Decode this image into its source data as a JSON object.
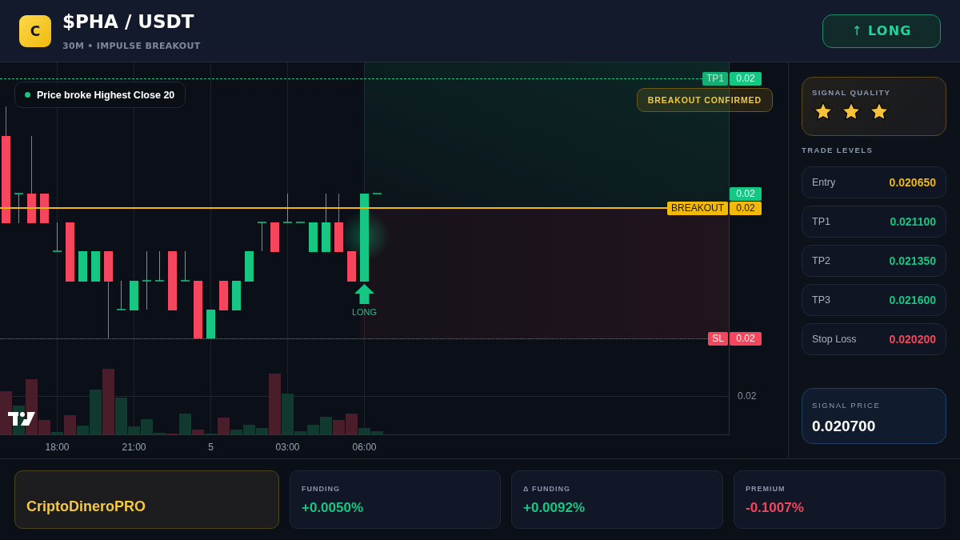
{
  "header": {
    "logo_letter": "C",
    "title": "$PHA / USDT",
    "subtitle": "30M • IMPULSE BREAKOUT",
    "direction": {
      "arrow": "↑",
      "label": "LONG"
    }
  },
  "chart": {
    "legend": "Price broke Highest Close 20",
    "badge": "BREAKOUT CONFIRMED",
    "price_lines": [
      {
        "kind": "take_profit",
        "label": "TP1",
        "value": "0.02"
      },
      {
        "kind": "last_price",
        "value": "0.02"
      },
      {
        "kind": "breakout",
        "label": "BREAKOUT",
        "value": "0.02"
      },
      {
        "kind": "stop_loss",
        "label": "SL",
        "value": "0.02"
      }
    ],
    "axis_labels": [
      "0.02"
    ],
    "time_labels": [
      "18:00",
      "21:00",
      "5",
      "03:00",
      "06:00"
    ],
    "signal_marker": "LONG"
  },
  "sidebar": {
    "signal_quality": {
      "title": "SIGNAL QUALITY",
      "stars": 3
    },
    "trade_levels": {
      "title": "TRADE LEVELS",
      "levels": [
        {
          "kind": "entry",
          "label": "Entry",
          "value": "0.020650"
        },
        {
          "kind": "target",
          "label": "TP1",
          "value": "0.021100"
        },
        {
          "kind": "target",
          "label": "TP2",
          "value": "0.021350"
        },
        {
          "kind": "target",
          "label": "TP3",
          "value": "0.021600"
        },
        {
          "kind": "stop",
          "label": "Stop Loss",
          "value": "0.020200"
        }
      ]
    },
    "signal_price": {
      "title": "SIGNAL PRICE",
      "value": "0.020700"
    }
  },
  "footer": {
    "brand": "CriptoDineroPRO",
    "stats": [
      {
        "kind": "positive",
        "label": "FUNDING",
        "value": "+0.0050%"
      },
      {
        "kind": "positive",
        "label": "Δ FUNDING",
        "value": "+0.0092%"
      },
      {
        "kind": "negative",
        "label": "PREMIUM",
        "value": "-0.1007%"
      }
    ]
  }
}
